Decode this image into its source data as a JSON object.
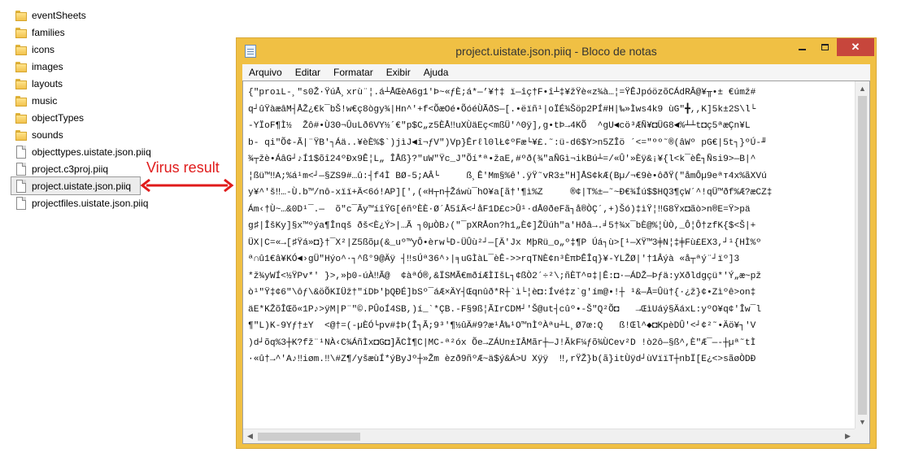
{
  "explorer": {
    "items": [
      {
        "name": "eventSheets",
        "type": "folder"
      },
      {
        "name": "families",
        "type": "folder"
      },
      {
        "name": "icons",
        "type": "folder"
      },
      {
        "name": "images",
        "type": "folder"
      },
      {
        "name": "layouts",
        "type": "folder"
      },
      {
        "name": "music",
        "type": "folder"
      },
      {
        "name": "objectTypes",
        "type": "folder"
      },
      {
        "name": "sounds",
        "type": "folder"
      },
      {
        "name": "objecttypes.uistate.json.piiq",
        "type": "file"
      },
      {
        "name": "project.c3proj.piiq",
        "type": "file"
      },
      {
        "name": "project.uistate.json.piiq",
        "type": "file",
        "selected": true
      },
      {
        "name": "projectfiles.uistate.json.piiq",
        "type": "file"
      }
    ]
  },
  "annotation": {
    "label": "Virus result",
    "color": "#e01b1b"
  },
  "notepad": {
    "title": "project.uistate.json.piiq - Bloco de notas",
    "menu": [
      "Arquivo",
      "Editar",
      "Formatar",
      "Exibir",
      "Ajuda"
    ],
    "lines": [
      "{\"proıL-¸\"s0Ž·ŸúÅ¸xrù¨¦.á┴ÅŒèA6g1'Þ~«ƒÈ;á*—’¥†‡ ï—îç†F•î┴‡¥žŸè«z¾à…¦=ŸÊJpóözõCÁdRÂ@¥╥•± €úmž#",
      "q┘ûŸàæâM┤ÅŽ¿€k¯bŠ!w€ç8ògy¾|Hn^'+f<ÕæOé•ÕóéÙÃðS—[.•ëïñ¹|oÏÉ¾Šöp2PÍ#H|‰»Ìws4k9 ùG\"╋,,K]5k±2S\\l└",
      "-YÏoF¶Ì½  Žô#•Ù3Θ¬ÛuLð6VY½´€\"p$C„z5ÈÅ‼uXÙäEç<mßÜ'^Θÿ],g•tÞ→4KÕ  ^gU◄cö³ÆÑ¥◘ÜG8◄%┴┴t◘ç5ªæÇn¥L",
      "b- qi\"Õ¢-Ã|¨ŸB'┐Áä..¥èÈ%$`)jìJ◄î¬ƒV\")Vp}Êrℓl0lŁ¢ºFæ└¥£.˜:ü-d6$Y>n5ZÎö ´<=\"ºº˜®(âWº pG€|5t┐}ºÚ-╜",
      "¾┬žè•ÁâG┘♪Í1$õî24ºÐx9Ê¦L„ ÎÅß}?\"uW\"Ÿc_J\"Õí*ª•žaE,#ºð(¾\"aÑGì¬ikBú┴=/«Û'»Èÿ&¡¥{l<k¯èÊ┐Ñsi9>—B|^",
      "¦ßü™‼A;%á¹m<┘—§ZS9#…û:┤f4Ì BØ-5;AÂ└     ß¸Ê'Mm§%ê'.ÿŸ˜vR3±\"H]ÅS¢kÆ(Bµ/¬€9è•ôðŸ(\"åmÔµ9eªᴛ4x%ãXVú",
      "y¥^'š‼…-Ù.b™/nô-xïï+Ä<6ó!AP][',(«H┬n┼Žáwù¯hO¥a[ã†'¶ì%Z     ®¢|T%±—˜~Ð€¾Íú$$HQ3¶çW´^!qÜ™ðf%Æ?æCZ‡",
      "Ám‹†Ù~…&0D¹¯.—  õ\"c¯Ãy™íîŸG[éñºÈÈ·Ø´Å5îÄ<┘åF1D£c>Û¹·dÅ0ðeFã┐å®ÒÇ´,+)Šó)‡ìŸ¦‼G8Ÿx◘ãò>n®E=Ÿ>pä",
      "g♯|ÎšKy]§x™ºýa¶Înqš ðš<È¿Ý>|…Ã ┐0µÒB♪(\"¯pXRÅon?h1„È¢]ŽÜúh\"a'Hðâ→.╛5†¾x¯bÈ@%¦ÙÒ,_Ô¦Ô†zfK{$<Š|+",
      "ÜX|C=«→[♯Ÿá»◘}†¯X²|Z5ßõµ(&_uº™yÔ•èrw└D-ÜÛù²┘—[Ä'Jx MþRü_o„º‡¶P Úá┐ù>[¹—XŸ™3╪N¦‡╪Fù£EX3,┘¹{HÌ%º",
      "ª∩û1€â¥KÓ◄›gÜ\"Hýo^·┐^ß°9@Äÿ ┤‼sÚª36^›|╕uGÌàL¯èÊ->>rqTNÈ¢n³ÈπÞÊÎq}¥-YLŽØ|'†1Âýà «å┬ªý¨┘ïº]3",
      "*ž¾yWÍ<½ŸPv*' }>,»þ0-úÀ‼Ã@  ¢àªÓ®,&ÏSMÃ€mðíÆÌIšL┐¢ßÒ2´÷²\\;ñÈT^¤‡|Ê:◘·—ÁDŽ—Þƒä:yXðldgçü*'Ý„æ~pž",
      "ò¹\"Ÿ‡¢6\"\\ôƒ\\&öÕKIÜž†\"íDÞ'þQÐÉ]bSº¯áÆ×ÄY┤Œqnûð*R┼`ì└¦è◘:Ívé‡z`g'ím@•!┼ ¹&—Å=Ûü†{·¿ž}¢•Zìºê>on‡",
      "äE*KŽõÎŒõ«1P♪>ÿM|P¨\"©.PÛoÍ4SB,)í_`*ÇB.-F§9ß¦ÃIrCDM┘'Š@ut┤cûº•-Š\"Q²Õ◘   →ŒìUáý§ÄáxL:yºO¥q¢'Îw¯l",
      "¶\"L)K-9Yƒ†±Y  <@†=(-µÈÓ└pv#‡Þ(Î┐Ã;9³'¶½ûÄ#9?æ¹Å‰¹O™nÌºÀªu┴L¸Ø7œ:Q   ß!Œl^◆◘KpèDÛ'<┘¢²˜•Äö¥┐'V",
      ")d┘õq%3┼K?fž¨¹NÀ‹C¾ÁñÌx◘G◘]ÃCÌ¶C|MC-ª²óx Õe→ZÁUn±IÂMãr┼—J!ÃkF¼ƒõ¾ÙCev²D !ò2ô—§ß^,È\"Æ¯—-┼µª˜tÌ",
      "·«û†→^'A♪‼iøm.‼\\#Z¶/yšæùÍ*ýByJº┼»Žm èzð9ñºÆ~ä$ý&Á>U Xÿÿ  ‼,rŸŽ}b(ã}itÙÿd┘ùVïïT┼nbÏ[E¿<>sãøÒDÐ"
    ]
  }
}
